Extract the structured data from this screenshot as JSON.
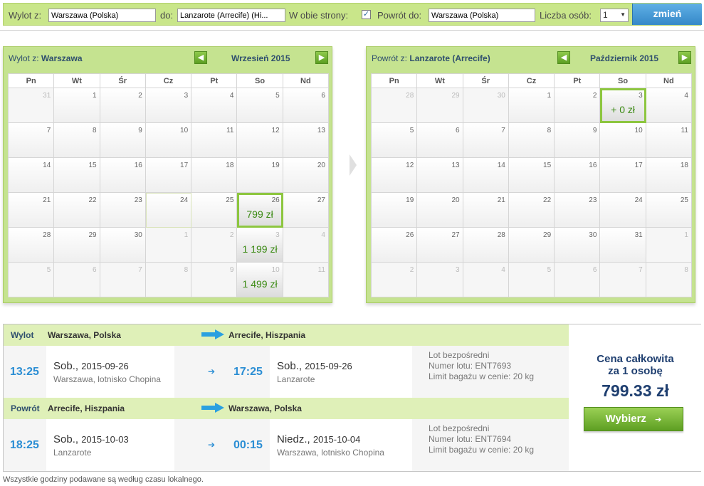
{
  "search": {
    "from_label": "Wylot z:",
    "from_value": "Warszawa (Polska)",
    "to_label": "do:",
    "to_value": "Lanzarote (Arrecife) (Hi...",
    "both_ways_label": "W obie strony:",
    "both_ways_checked": "✓",
    "return_label": "Powrót do:",
    "return_value": "Warszawa (Polska)",
    "persons_label": "Liczba osób:",
    "persons_value": "1",
    "submit_label": "zmień"
  },
  "weekdays": [
    "Pn",
    "Wt",
    "Śr",
    "Cz",
    "Pt",
    "So",
    "Nd"
  ],
  "outbound_calendar": {
    "title_prefix": "Wylot z:",
    "title_city": "Warszawa",
    "month": "Wrzesień 2015",
    "days": [
      {
        "n": "31",
        "o": true
      },
      {
        "n": "1"
      },
      {
        "n": "2"
      },
      {
        "n": "3"
      },
      {
        "n": "4"
      },
      {
        "n": "5"
      },
      {
        "n": "6"
      },
      {
        "n": "7"
      },
      {
        "n": "8"
      },
      {
        "n": "9"
      },
      {
        "n": "10"
      },
      {
        "n": "11"
      },
      {
        "n": "12"
      },
      {
        "n": "13"
      },
      {
        "n": "14"
      },
      {
        "n": "15"
      },
      {
        "n": "16"
      },
      {
        "n": "17"
      },
      {
        "n": "18"
      },
      {
        "n": "19"
      },
      {
        "n": "20"
      },
      {
        "n": "21"
      },
      {
        "n": "22"
      },
      {
        "n": "23"
      },
      {
        "n": "24",
        "h": true
      },
      {
        "n": "25"
      },
      {
        "n": "26",
        "p": "799 zł",
        "s": true
      },
      {
        "n": "27"
      },
      {
        "n": "28"
      },
      {
        "n": "29"
      },
      {
        "n": "30"
      },
      {
        "n": "1",
        "o": true
      },
      {
        "n": "2",
        "o": true
      },
      {
        "n": "3",
        "o": true,
        "p": "1 199 zł"
      },
      {
        "n": "4",
        "o": true
      },
      {
        "n": "5",
        "o": true
      },
      {
        "n": "6",
        "o": true
      },
      {
        "n": "7",
        "o": true
      },
      {
        "n": "8",
        "o": true
      },
      {
        "n": "9",
        "o": true
      },
      {
        "n": "10",
        "o": true,
        "p": "1 499 zł"
      },
      {
        "n": "11",
        "o": true
      }
    ]
  },
  "return_calendar": {
    "title_prefix": "Powrót z:",
    "title_city": "Lanzarote (Arrecife)",
    "month": "Październik 2015",
    "days": [
      {
        "n": "28",
        "o": true
      },
      {
        "n": "29",
        "o": true
      },
      {
        "n": "30",
        "o": true
      },
      {
        "n": "1"
      },
      {
        "n": "2"
      },
      {
        "n": "3",
        "p": "+ 0 zł",
        "s": true
      },
      {
        "n": "4"
      },
      {
        "n": "5"
      },
      {
        "n": "6"
      },
      {
        "n": "7"
      },
      {
        "n": "8"
      },
      {
        "n": "9"
      },
      {
        "n": "10"
      },
      {
        "n": "11"
      },
      {
        "n": "12"
      },
      {
        "n": "13"
      },
      {
        "n": "14"
      },
      {
        "n": "15"
      },
      {
        "n": "16"
      },
      {
        "n": "17"
      },
      {
        "n": "18"
      },
      {
        "n": "19"
      },
      {
        "n": "20"
      },
      {
        "n": "21"
      },
      {
        "n": "22"
      },
      {
        "n": "23"
      },
      {
        "n": "24"
      },
      {
        "n": "25"
      },
      {
        "n": "26"
      },
      {
        "n": "27"
      },
      {
        "n": "28"
      },
      {
        "n": "29"
      },
      {
        "n": "30"
      },
      {
        "n": "31"
      },
      {
        "n": "1",
        "o": true
      },
      {
        "n": "2",
        "o": true
      },
      {
        "n": "3",
        "o": true
      },
      {
        "n": "4",
        "o": true
      },
      {
        "n": "5",
        "o": true
      },
      {
        "n": "6",
        "o": true
      },
      {
        "n": "7",
        "o": true
      },
      {
        "n": "8",
        "o": true
      }
    ]
  },
  "outbound": {
    "label": "Wylot",
    "from": "Warszawa, Polska",
    "to": "Arrecife, Hiszpania",
    "dep_time": "13:25",
    "dep_day": "Sob.,",
    "dep_date": "2015-09-26",
    "dep_place": "Warszawa, lotnisko Chopina",
    "arr_time": "17:25",
    "arr_day": "Sob.,",
    "arr_date": "2015-09-26",
    "arr_place": "Lanzarote",
    "flight_type": "Lot bezpośredni",
    "flight_no": "Numer lotu: ENT7693",
    "baggage": "Limit bagażu w cenie: 20 kg"
  },
  "inbound": {
    "label": "Powrót",
    "from": "Arrecife, Hiszpania",
    "to": "Warszawa, Polska",
    "dep_time": "18:25",
    "dep_day": "Sob.,",
    "dep_date": "2015-10-03",
    "dep_place": "Lanzarote",
    "arr_time": "00:15",
    "arr_day": "Niedz.,",
    "arr_date": "2015-10-04",
    "arr_place": "Warszawa, lotnisko Chopina",
    "flight_type": "Lot bezpośredni",
    "flight_no": "Numer lotu: ENT7694",
    "baggage": "Limit bagażu w cenie: 20 kg"
  },
  "price": {
    "caption_line1": "Cena całkowita",
    "caption_line2": "za 1 osobę",
    "amount": "799.33 zł",
    "choose_label": "Wybierz"
  },
  "footnote": "Wszystkie godziny podawane są według czasu lokalnego.",
  "icons": {
    "prev": "arrow-left-icon",
    "next": "arrow-right-icon",
    "route": "route-arrow-icon"
  },
  "colors": {
    "bar_green": "#c9e68a",
    "price_green": "#3b8a14",
    "time_blue": "#2b8ed4",
    "button_blue": "#3588c8"
  }
}
